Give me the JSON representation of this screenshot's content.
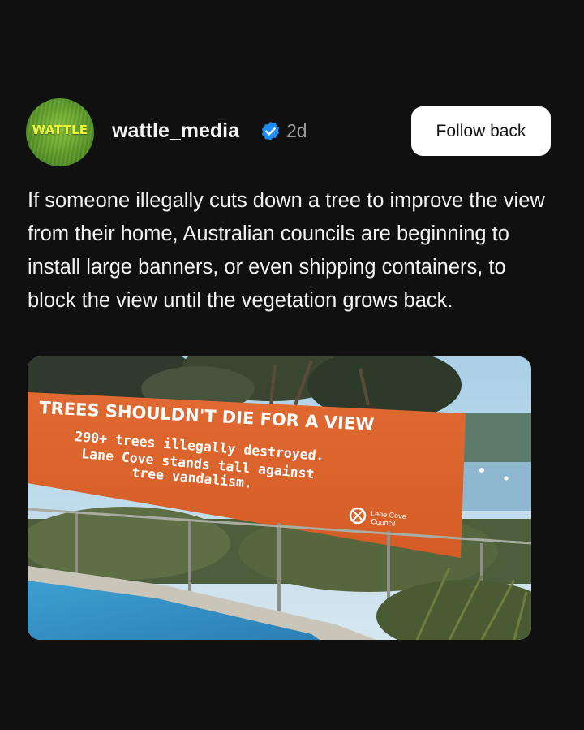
{
  "author": {
    "avatar_logo_text": "WATTLE",
    "username": "wattle_media",
    "verified": true,
    "time_ago": "2d"
  },
  "actions": {
    "follow_label": "Follow back"
  },
  "post": {
    "caption": "If someone illegally cuts down a tree to improve the view from their home, Australian councils are beginning to install large banners, or even shipping containers, to block the view until the vegetation grows back."
  },
  "image": {
    "banner_headline": "TREES SHOULDN'T DIE FOR A VIEW",
    "banner_line1": "290+ trees illegally destroyed.",
    "banner_line2": "Lane Cove stands tall against",
    "banner_line3": "tree vandalism.",
    "banner_org_line1": "Lane Cove",
    "banner_org_line2": "Council"
  },
  "colors": {
    "background": "#101010",
    "banner_orange": "#d9622b",
    "verified_blue": "#1d8df2"
  },
  "icons": {
    "verified": "verified-badge-icon",
    "council_logo": "council-logo-icon"
  }
}
